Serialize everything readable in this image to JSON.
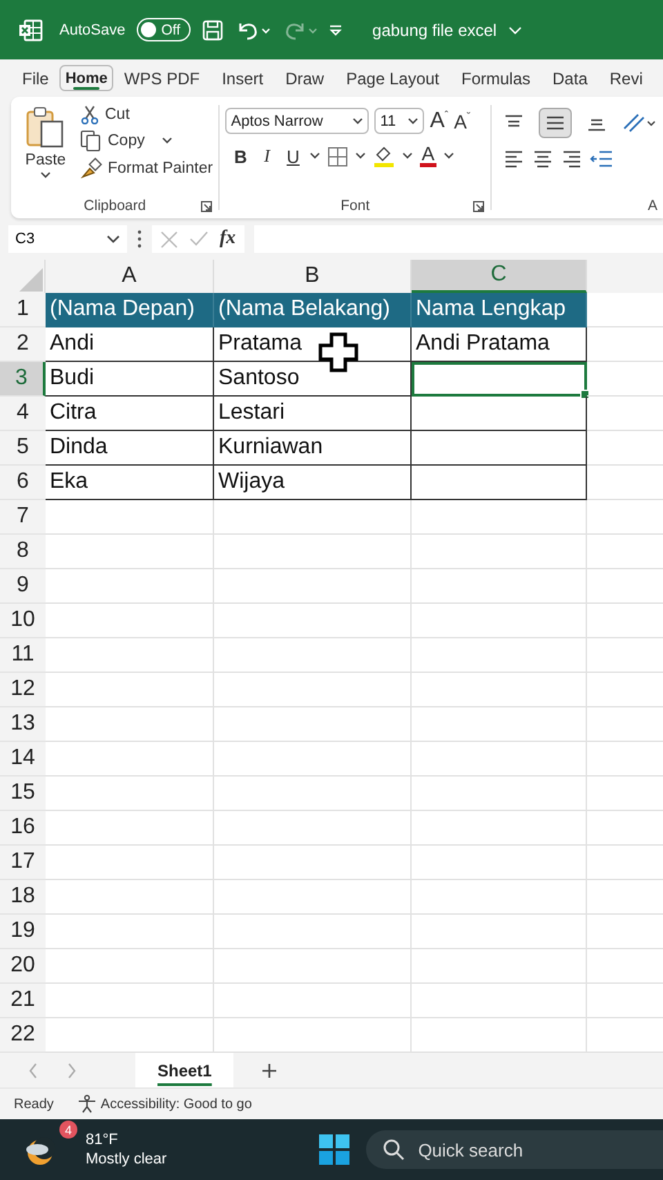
{
  "title_bar": {
    "autosave_label": "AutoSave",
    "autosave_on": false,
    "toggle_text": "Off",
    "filename": "gabung file excel"
  },
  "menu_tabs": [
    {
      "label": "File",
      "selected": false
    },
    {
      "label": "Home",
      "selected": true
    },
    {
      "label": "WPS PDF",
      "selected": false
    },
    {
      "label": "Insert",
      "selected": false
    },
    {
      "label": "Draw",
      "selected": false
    },
    {
      "label": "Page Layout",
      "selected": false
    },
    {
      "label": "Formulas",
      "selected": false
    },
    {
      "label": "Data",
      "selected": false
    },
    {
      "label": "Revi",
      "selected": false
    }
  ],
  "ribbon": {
    "paste": "Paste",
    "cut": "Cut",
    "copy": "Copy",
    "format_painter": "Format Painter",
    "clipboard_group": "Clipboard",
    "font_name": "Aptos Narrow",
    "font_size": "11",
    "grow_font": "A",
    "grow_mark": "ˆ",
    "shrink_font": "A",
    "shrink_mark": "ˇ",
    "style_buttons": [
      "B",
      "I",
      "U"
    ],
    "font_color": "A",
    "font_group": "Font",
    "alignment_group": "A",
    "vertical_align": [
      {
        "kind": "top",
        "selected": false
      },
      {
        "kind": "middle",
        "selected": true
      },
      {
        "kind": "bottom",
        "selected": false
      }
    ]
  },
  "formula_bar": {
    "name_box": "C3",
    "function_label": "fx"
  },
  "columns": [
    {
      "label": "A",
      "selected": false
    },
    {
      "label": "B",
      "selected": false
    },
    {
      "label": "C",
      "selected": true
    }
  ],
  "rows": [
    {
      "number": "1",
      "selected": false,
      "kind": "header",
      "cells": [
        {
          "text": "(Nama Depan)",
          "selected": false
        },
        {
          "text": "(Nama Belakang)",
          "selected": false
        },
        {
          "text": "Nama Lengkap",
          "selected": false
        }
      ]
    },
    {
      "number": "2",
      "selected": false,
      "kind": "data",
      "cells": [
        {
          "text": "Andi",
          "selected": false
        },
        {
          "text": "Pratama",
          "selected": false
        },
        {
          "text": "Andi Pratama",
          "selected": false
        }
      ]
    },
    {
      "number": "3",
      "selected": true,
      "kind": "data",
      "cells": [
        {
          "text": "Budi",
          "selected": false
        },
        {
          "text": "Santoso",
          "selected": false
        },
        {
          "selected": true
        }
      ]
    },
    {
      "number": "4",
      "selected": false,
      "kind": "data",
      "cells": [
        {
          "text": "Citra",
          "selected": false
        },
        {
          "text": "Lestari",
          "selected": false
        },
        {
          "selected": false
        }
      ]
    },
    {
      "number": "5",
      "selected": false,
      "kind": "data",
      "cells": [
        {
          "text": "Dinda",
          "selected": false
        },
        {
          "text": "Kurniawan",
          "selected": false
        },
        {
          "selected": false
        }
      ]
    },
    {
      "number": "6",
      "selected": false,
      "kind": "data",
      "cells": [
        {
          "text": "Eka",
          "selected": false
        },
        {
          "text": "Wijaya",
          "selected": false
        },
        {
          "selected": false
        }
      ]
    },
    {
      "number": "7",
      "selected": false
    },
    {
      "number": "8",
      "selected": false
    },
    {
      "number": "9",
      "selected": false
    },
    {
      "number": "10",
      "selected": false
    },
    {
      "number": "11",
      "selected": false
    },
    {
      "number": "12",
      "selected": false
    },
    {
      "number": "13",
      "selected": false
    },
    {
      "number": "14",
      "selected": false
    },
    {
      "number": "15",
      "selected": false
    },
    {
      "number": "16",
      "selected": false
    },
    {
      "number": "17",
      "selected": false
    },
    {
      "number": "18",
      "selected": false
    },
    {
      "number": "19",
      "selected": false
    },
    {
      "number": "20",
      "selected": false
    },
    {
      "number": "21",
      "selected": false
    },
    {
      "number": "22",
      "selected": false
    }
  ],
  "sheet_tabs": [
    {
      "label": "Sheet1",
      "selected": true
    }
  ],
  "status_bar": {
    "status": "Ready",
    "accessibility": "Accessibility: Good to go"
  },
  "taskbar": {
    "weather_badge": "4",
    "temperature": "81°F",
    "condition": "Mostly clear",
    "search_placeholder": "Quick search"
  }
}
